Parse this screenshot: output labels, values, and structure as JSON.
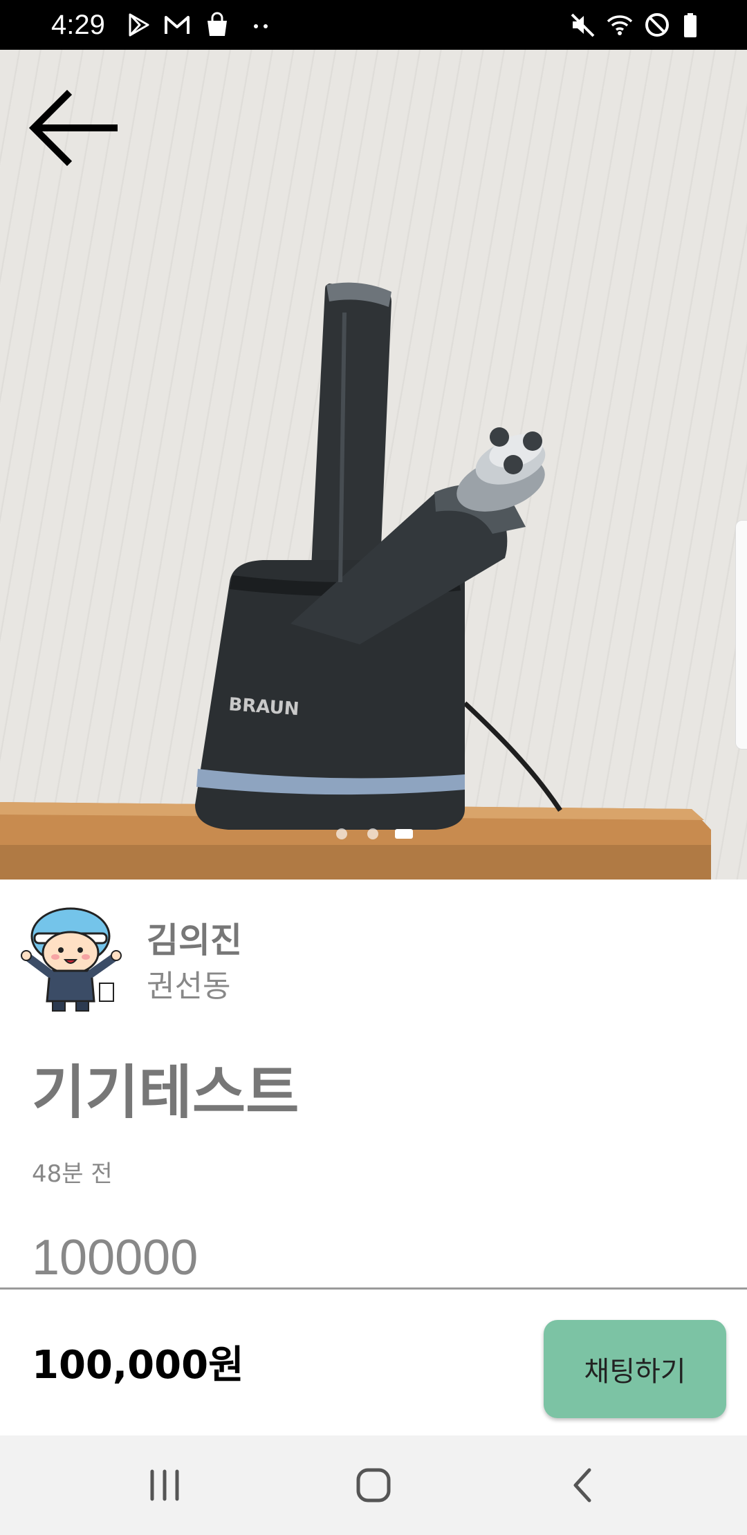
{
  "status_bar": {
    "time": "4:29",
    "left_icons": [
      "play-store-icon",
      "gmail-icon",
      "shopping-bag-icon",
      "more-dots-icon"
    ],
    "right_icons": [
      "mute-icon",
      "wifi-icon",
      "do-not-disturb-icon",
      "battery-icon"
    ]
  },
  "hero": {
    "back_icon": "arrow-left-icon",
    "photo_subject": "electric shaver on charging stand",
    "product_brand_mark": "BRAUN",
    "pager": {
      "count": 3,
      "active_index": 2
    }
  },
  "seller": {
    "name": "김의진",
    "location": "권선동"
  },
  "post": {
    "title": "기기테스트",
    "time_ago": "48분 전",
    "body": "100000"
  },
  "bottom_bar": {
    "price": "100,000원",
    "chat_button_label": "채팅하기"
  },
  "colors": {
    "chat_button": "#7cc3a4",
    "muted_text": "#777777",
    "status_bar": "#000000",
    "nav_bar": "#f2f2f2"
  },
  "nav_bar": {
    "icons": [
      "recent-apps-icon",
      "home-icon",
      "back-nav-icon"
    ]
  }
}
